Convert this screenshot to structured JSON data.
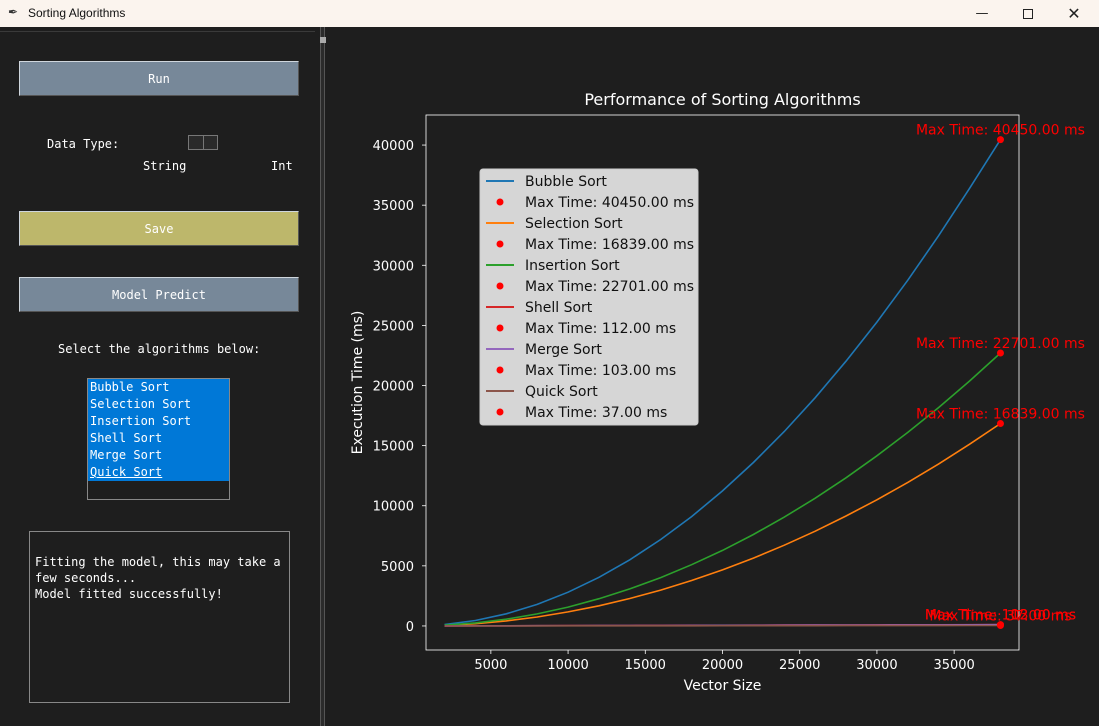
{
  "window": {
    "title": "Sorting Algorithms",
    "min_glyph": "—",
    "close_glyph": "✕",
    "icon": "feather-icon"
  },
  "controls": {
    "run_label": "Run",
    "data_type_label": "Data Type:",
    "string_label": "String",
    "int_label": "Int",
    "save_label": "Save",
    "predict_label": "Model Predict",
    "select_prompt": "Select the algorithms below:",
    "colors": {
      "run": "#778899",
      "save": "#bdb76b",
      "predict": "#778899"
    }
  },
  "algorithms": [
    "Bubble Sort",
    "Selection Sort",
    "Insertion Sort",
    "Shell Sort",
    "Merge Sort",
    "Quick Sort"
  ],
  "log": [
    "Fitting the model, this may take a",
    "few seconds...",
    "Model fitted successfully!"
  ],
  "chart_data": {
    "type": "line",
    "title": "Performance of Sorting Algorithms",
    "xlabel": "Vector Size",
    "ylabel": "Execution Time (ms)",
    "xlim": [
      800,
      39200
    ],
    "ylim": [
      -2000,
      42500
    ],
    "xticks": [
      5000,
      10000,
      15000,
      20000,
      25000,
      30000,
      35000
    ],
    "yticks": [
      0,
      5000,
      10000,
      15000,
      20000,
      25000,
      30000,
      35000,
      40000
    ],
    "grid": false,
    "legend_position": "upper left",
    "x": [
      2000,
      4000,
      6000,
      8000,
      10000,
      12000,
      14000,
      16000,
      18000,
      20000,
      22000,
      24000,
      26000,
      28000,
      30000,
      32000,
      34000,
      36000,
      38000
    ],
    "series": [
      {
        "name": "Bubble Sort",
        "color": "#1f77b4",
        "values": [
          112,
          450,
          1011,
          1797,
          2809,
          4044,
          5505,
          7190,
          9100,
          11235,
          13594,
          16178,
          18987,
          22020,
          25278,
          28761,
          32469,
          36400,
          40450
        ],
        "max_label": "Max Time: 40450.00 ms"
      },
      {
        "name": "Selection Sort",
        "color": "#ff7f0e",
        "values": [
          47,
          187,
          420,
          746,
          1166,
          1679,
          2286,
          2986,
          3779,
          4665,
          5645,
          6718,
          7884,
          9143,
          10496,
          11942,
          13481,
          15114,
          16839
        ],
        "max_label": "Max Time: 16839.00 ms"
      },
      {
        "name": "Insertion Sort",
        "color": "#2ca02c",
        "values": [
          63,
          252,
          566,
          1006,
          1572,
          2264,
          3081,
          4024,
          5093,
          6288,
          7609,
          9055,
          10627,
          12325,
          14149,
          16099,
          18174,
          20375,
          22701
        ],
        "max_label": "Max Time: 22701.00 ms"
      },
      {
        "name": "Shell Sort",
        "color": "#d62728",
        "values": [
          4,
          10,
          15,
          21,
          27,
          33,
          39,
          45,
          51,
          57,
          63,
          69,
          75,
          81,
          87,
          93,
          99,
          105,
          112
        ],
        "max_label": "Max Time: 112.00 ms"
      },
      {
        "name": "Merge Sort",
        "color": "#9467bd",
        "values": [
          4,
          9,
          14,
          19,
          25,
          30,
          35,
          41,
          46,
          52,
          57,
          62,
          68,
          73,
          79,
          84,
          89,
          96,
          103
        ],
        "max_label": "Max Time: 103.00 ms"
      },
      {
        "name": "Quick Sort",
        "color": "#8c564b",
        "values": [
          1,
          3,
          5,
          7,
          9,
          11,
          13,
          15,
          17,
          19,
          21,
          23,
          25,
          27,
          29,
          31,
          33,
          35,
          37
        ],
        "max_label": "Max Time: 37.00 ms"
      }
    ],
    "max_marker_color": "#ff0000"
  }
}
